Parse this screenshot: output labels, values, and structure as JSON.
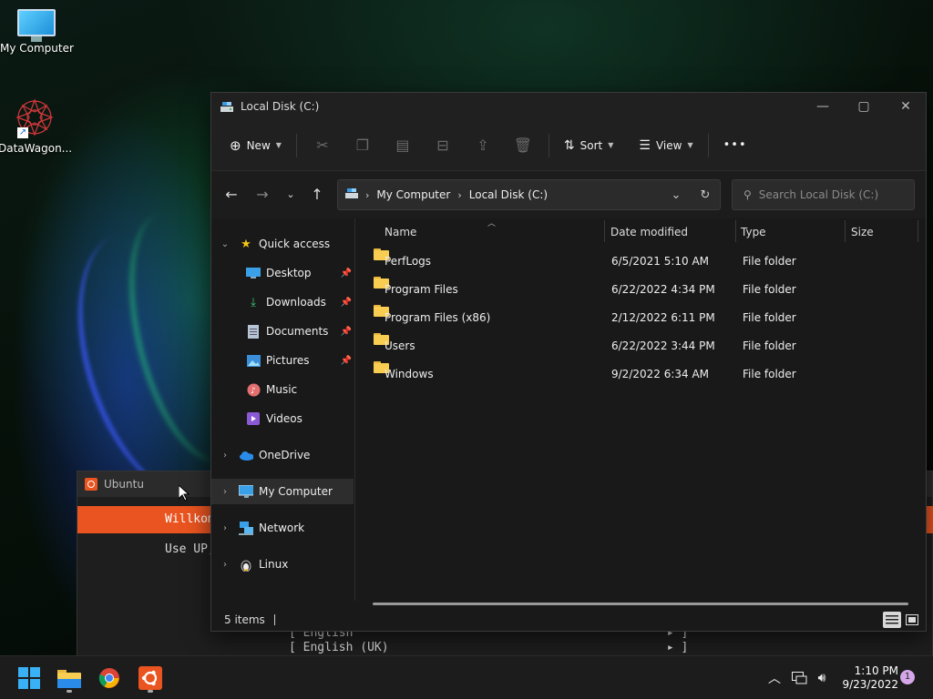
{
  "desktop": {
    "icons": [
      {
        "label": "My Computer"
      },
      {
        "label": "DataWagon..."
      }
    ]
  },
  "ubuntu": {
    "title": "Ubuntu",
    "banner": "Willkom",
    "line": "Use UP,",
    "options": [
      "[ English                                            ▸ ]",
      "[ English (UK)                                       ▸ ]"
    ]
  },
  "explorer": {
    "title": "Local Disk (C:)",
    "toolbar": {
      "new_label": "New",
      "sort_label": "Sort",
      "view_label": "View",
      "more_label": "•••"
    },
    "address": {
      "crumbs": [
        "My Computer",
        "Local Disk (C:)"
      ]
    },
    "search": {
      "placeholder": "Search Local Disk (C:)"
    },
    "nav": {
      "quick_access": "Quick access",
      "items": [
        {
          "label": "Desktop"
        },
        {
          "label": "Downloads"
        },
        {
          "label": "Documents"
        },
        {
          "label": "Pictures"
        },
        {
          "label": "Music"
        },
        {
          "label": "Videos"
        }
      ],
      "onedrive": "OneDrive",
      "my_computer": "My Computer",
      "network": "Network",
      "linux": "Linux"
    },
    "columns": {
      "name": "Name",
      "date": "Date modified",
      "type": "Type",
      "size": "Size"
    },
    "files": [
      {
        "name": "PerfLogs",
        "date": "6/5/2021 5:10 AM",
        "type": "File folder"
      },
      {
        "name": "Program Files",
        "date": "6/22/2022 4:34 PM",
        "type": "File folder"
      },
      {
        "name": "Program Files (x86)",
        "date": "2/12/2022 6:11 PM",
        "type": "File folder"
      },
      {
        "name": "Users",
        "date": "6/22/2022 3:44 PM",
        "type": "File folder"
      },
      {
        "name": "Windows",
        "date": "9/2/2022 6:34 AM",
        "type": "File folder"
      }
    ],
    "status": "5 items"
  },
  "taskbar": {
    "time": "1:10 PM",
    "date": "9/23/2022",
    "notifications": "1"
  },
  "colors": {
    "ubuntu_orange": "#e95420",
    "folder_yellow": "#f8cd52",
    "accent_blue": "#4cc2ff"
  }
}
